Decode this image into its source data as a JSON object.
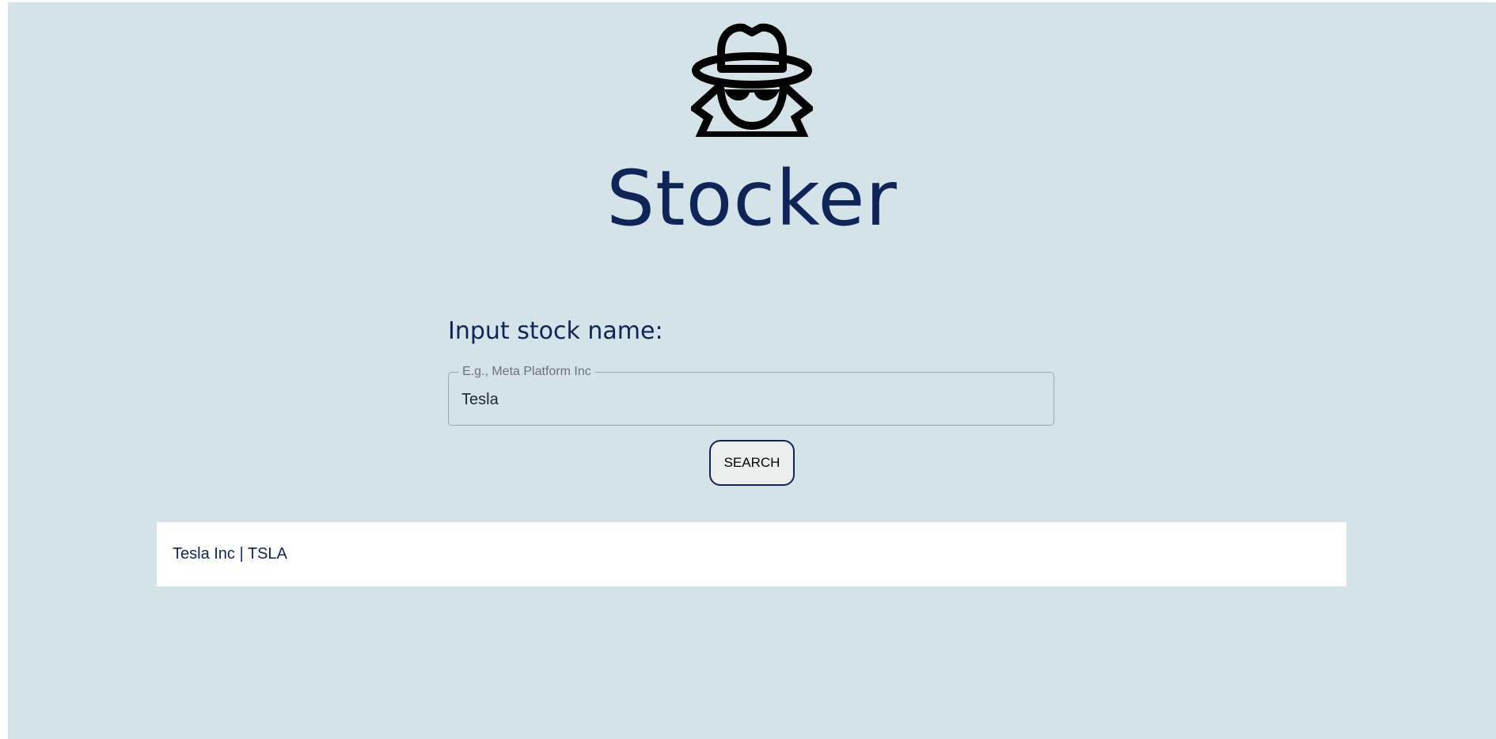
{
  "app": {
    "title": "Stocker",
    "logo_icon": "detective-spy-icon"
  },
  "search": {
    "label": "Input stock name:",
    "legend": "E.g., Meta Platform Inc",
    "value": "Tesla",
    "button_label": "SEARCH"
  },
  "results": [
    {
      "text": "Tesla Inc | TSLA"
    }
  ],
  "colors": {
    "background": "#d4e3e8",
    "title": "#0f2558",
    "results_background": "#ffffff"
  }
}
